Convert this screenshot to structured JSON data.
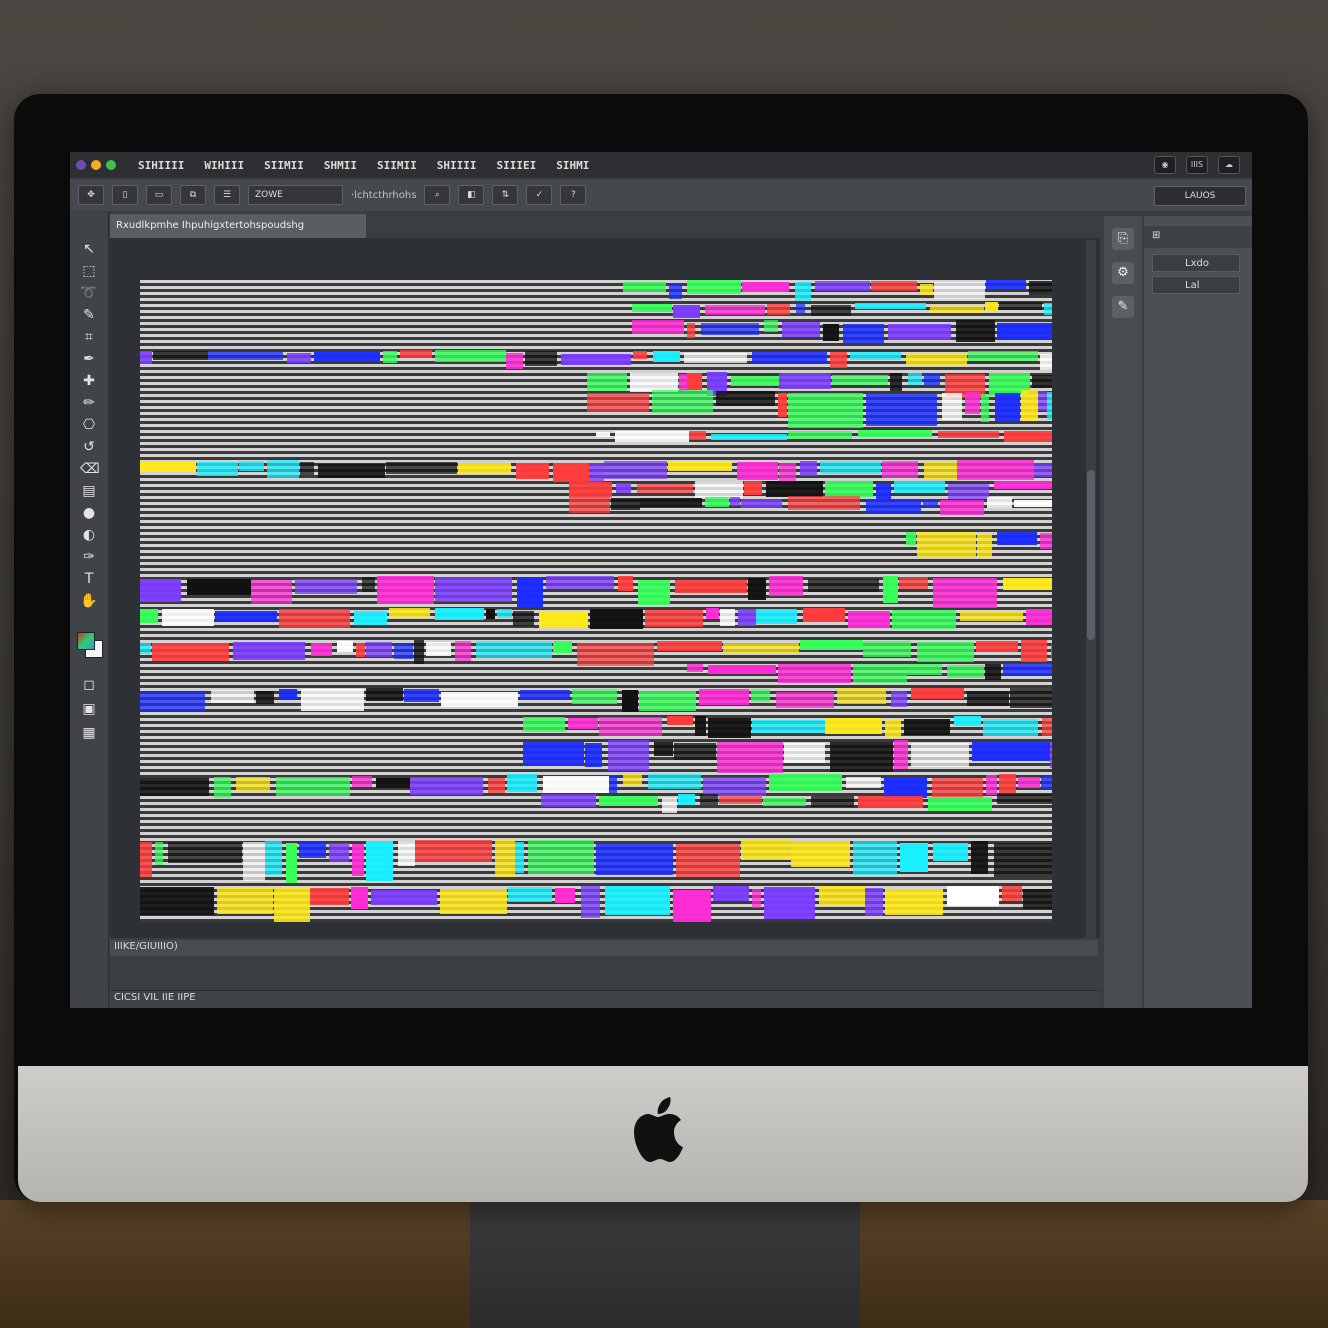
{
  "menubar": {
    "items": [
      "SIHIIII",
      "WIHIII",
      "SIIMII",
      "SHMII",
      "SIIMII",
      "SHIIII",
      "SIIIEI",
      "SIHMI"
    ],
    "right_buttons": [
      "◉",
      "IIIS",
      "☁"
    ],
    "light_colors": [
      "#6a4fb3",
      "#f2b01e",
      "#3ec24a"
    ]
  },
  "options": {
    "select_value": "ZOWE",
    "hint_text": "·lchtcthrhohs",
    "workspace": "LAUOS"
  },
  "document": {
    "tab_title": "Rxudlkpmhe Ihpuhigxtertohspoudshg",
    "zoom_readout": "IIIKE/GIUIIIO)",
    "status_text": "CICSI  VIL  IIE    IIPE"
  },
  "panel": {
    "tab_label": "⊞",
    "layers": [
      "Lxdo",
      "Lal"
    ]
  },
  "icons": {
    "move": "move-icon",
    "apple": "apple-logo"
  }
}
